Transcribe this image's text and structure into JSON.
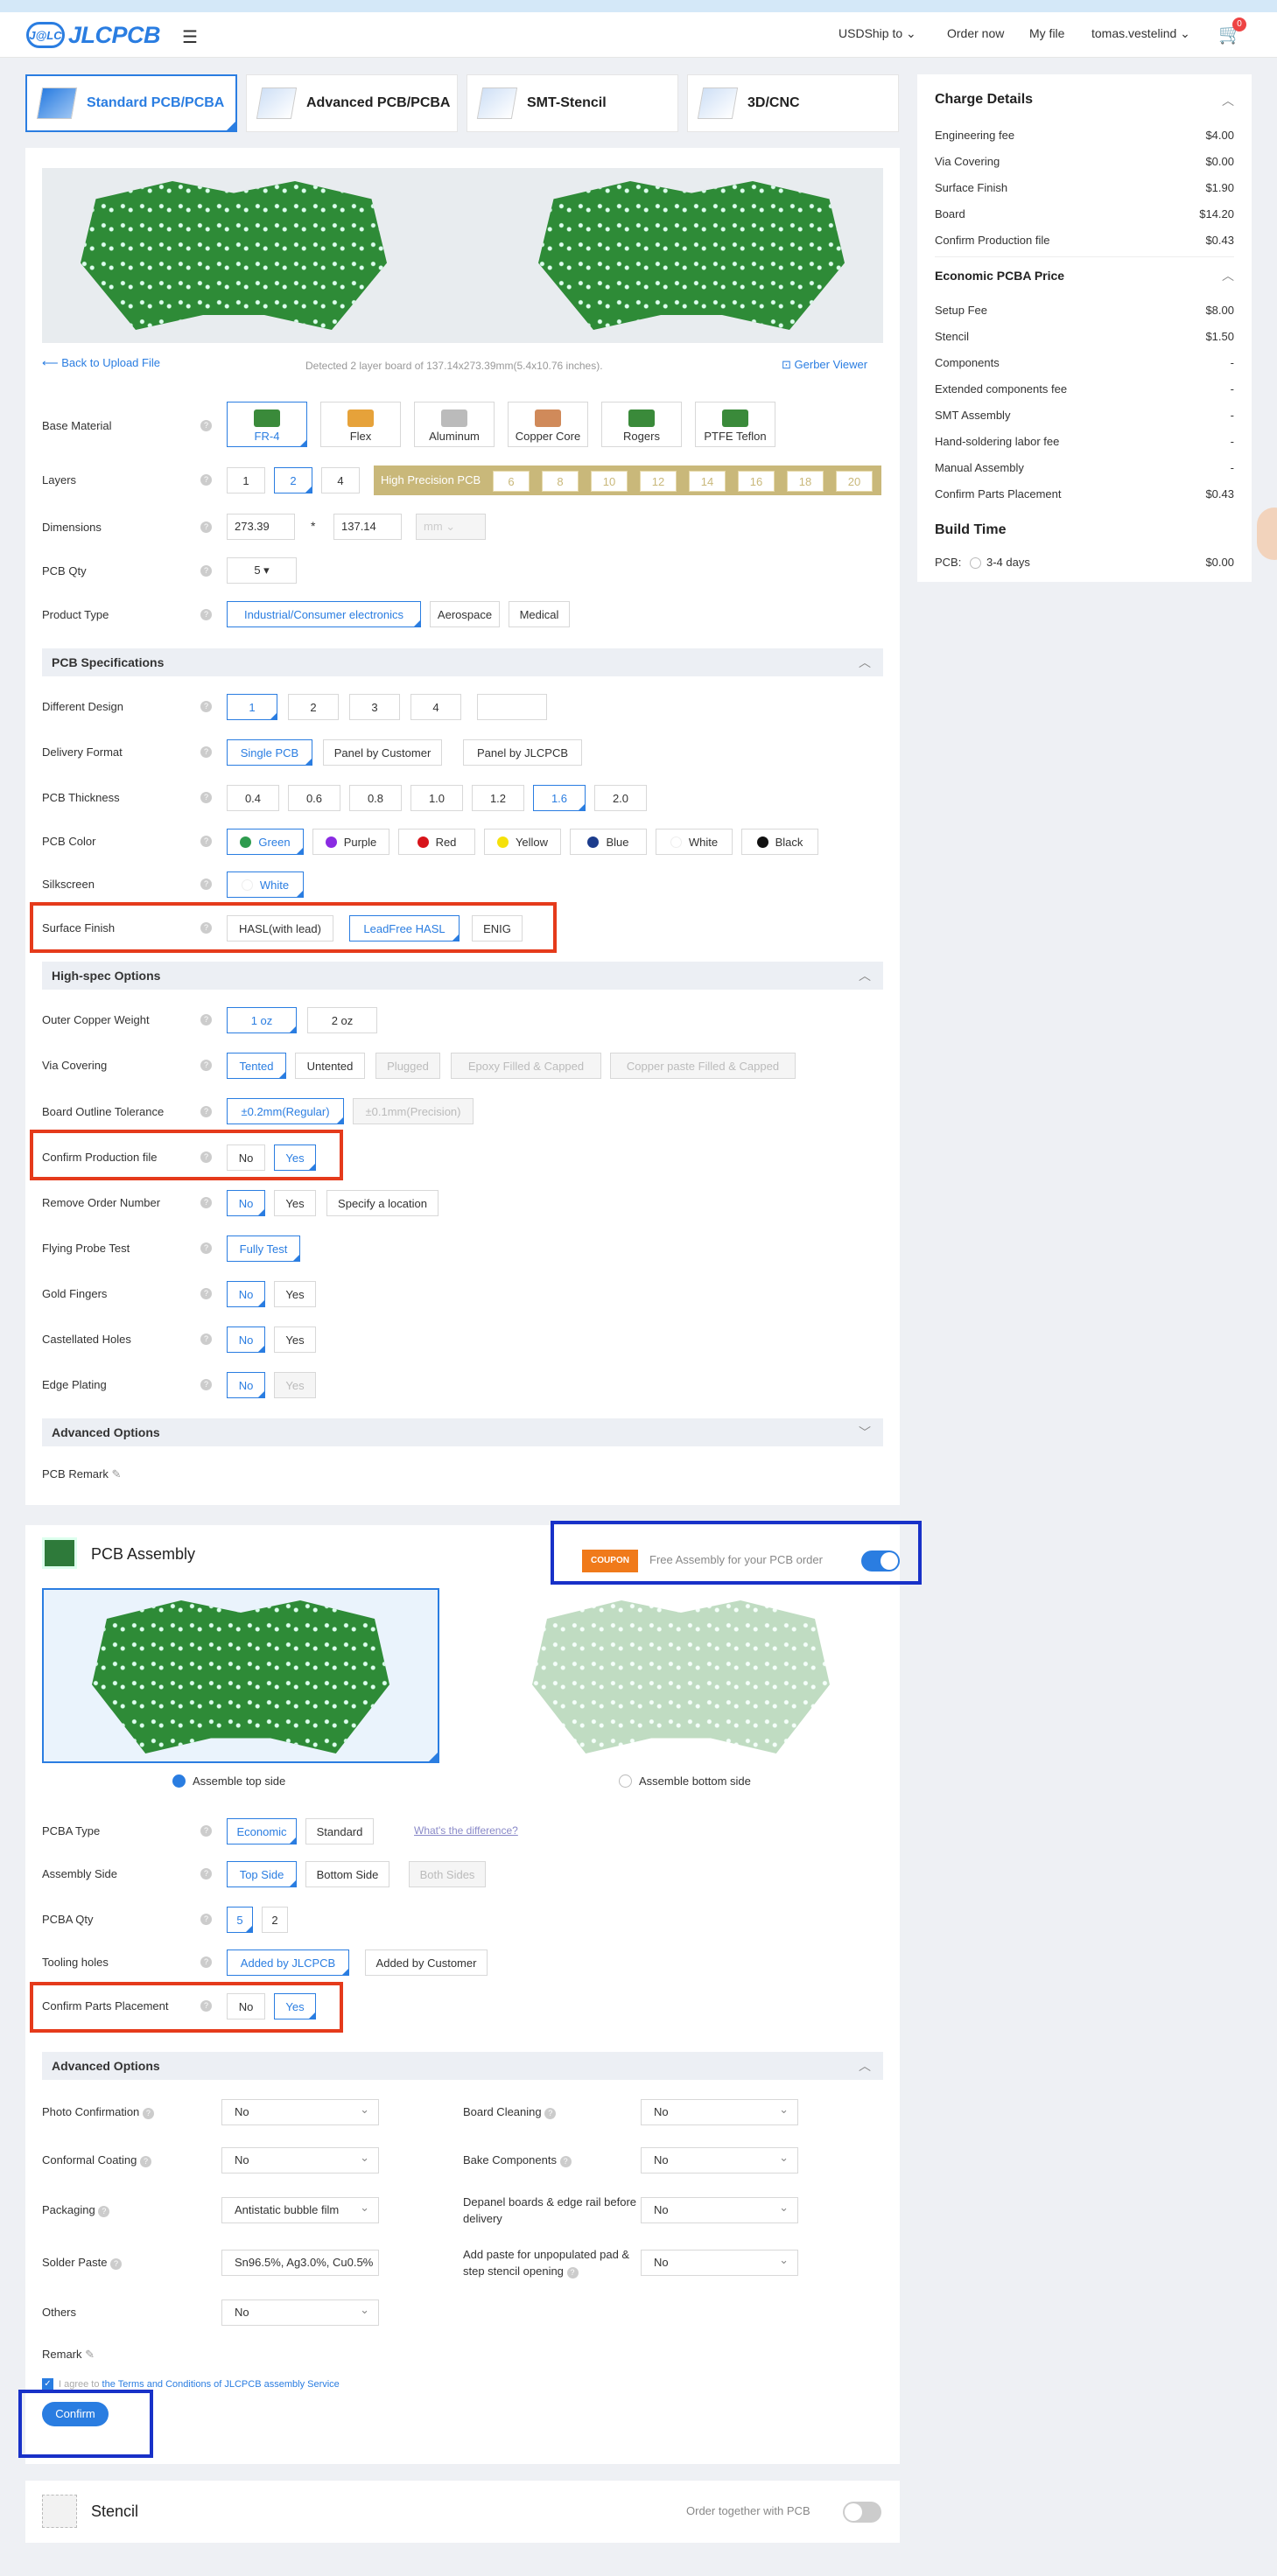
{
  "header": {
    "logo_mark": "J@LC",
    "logo_word": "JLCPCB",
    "currency": "USD",
    "ship_to": "Ship to",
    "order_now": "Order now",
    "my_file": "My file",
    "user": "tomas.vestelind",
    "cart_count": "0"
  },
  "tabs": [
    "Standard PCB/PCBA",
    "Advanced PCB/PCBA",
    "SMT-Stencil",
    "3D/CNC"
  ],
  "upload": {
    "back": "Back to Upload File",
    "detected": "Detected 2 layer board of 137.14x273.39mm(5.4x10.76 inches).",
    "gerber_viewer": "Gerber Viewer"
  },
  "base_material": {
    "label": "Base Material",
    "options": [
      "FR-4",
      "Flex",
      "Aluminum",
      "Copper Core",
      "Rogers",
      "PTFE Teflon"
    ]
  },
  "layers": {
    "label": "Layers",
    "options": [
      "1",
      "2",
      "4"
    ],
    "hp_label": "High Precision PCB",
    "hp_options": [
      "6",
      "8",
      "10",
      "12",
      "14",
      "16",
      "18",
      "20"
    ]
  },
  "dimensions": {
    "label": "Dimensions",
    "w": "273.39",
    "sep": "*",
    "h": "137.14",
    "unit": "mm"
  },
  "qty": {
    "label": "PCB Qty",
    "value": "5"
  },
  "product_type": {
    "label": "Product Type",
    "options": [
      "Industrial/Consumer electronics",
      "Aerospace",
      "Medical"
    ]
  },
  "spec_title": "PCB Specifications",
  "diff_design": {
    "label": "Different Design",
    "options": [
      "1",
      "2",
      "3",
      "4"
    ]
  },
  "delivery": {
    "label": "Delivery Format",
    "options": [
      "Single PCB",
      "Panel by Customer",
      "Panel by JLCPCB"
    ]
  },
  "thickness": {
    "label": "PCB Thickness",
    "options": [
      "0.4",
      "0.6",
      "0.8",
      "1.0",
      "1.2",
      "1.6",
      "2.0"
    ]
  },
  "color": {
    "label": "PCB Color",
    "options": [
      {
        "name": "Green",
        "c": "#2e9b4e"
      },
      {
        "name": "Purple",
        "c": "#8a2be2"
      },
      {
        "name": "Red",
        "c": "#d7141a"
      },
      {
        "name": "Yellow",
        "c": "#f5e10a"
      },
      {
        "name": "Blue",
        "c": "#1c3c8c"
      },
      {
        "name": "White",
        "c": "#ffffff"
      },
      {
        "name": "Black",
        "c": "#111111"
      }
    ]
  },
  "silkscreen": {
    "label": "Silkscreen",
    "value": "White"
  },
  "surface": {
    "label": "Surface Finish",
    "options": [
      "HASL(with lead)",
      "LeadFree HASL",
      "ENIG"
    ]
  },
  "highspec_title": "High-spec Options",
  "copper": {
    "label": "Outer Copper Weight",
    "options": [
      "1 oz",
      "2 oz"
    ]
  },
  "via": {
    "label": "Via Covering",
    "options": [
      "Tented",
      "Untented",
      "Plugged",
      "Epoxy Filled & Capped",
      "Copper paste Filled & Capped"
    ]
  },
  "tolerance": {
    "label": "Board Outline Tolerance",
    "options": [
      "±0.2mm(Regular)",
      "±0.1mm(Precision)"
    ]
  },
  "confirm_file": {
    "label": "Confirm Production file",
    "options": [
      "No",
      "Yes"
    ]
  },
  "remove_order": {
    "label": "Remove Order Number",
    "options": [
      "No",
      "Yes",
      "Specify a location"
    ]
  },
  "flying": {
    "label": "Flying Probe Test",
    "value": "Fully Test"
  },
  "gold": {
    "label": "Gold Fingers",
    "options": [
      "No",
      "Yes"
    ]
  },
  "castellated": {
    "label": "Castellated Holes",
    "options": [
      "No",
      "Yes"
    ]
  },
  "edge": {
    "label": "Edge Plating",
    "options": [
      "No",
      "Yes"
    ]
  },
  "adv_title": "Advanced Options",
  "remark_label": "PCB Remark",
  "assembly": {
    "title": "PCB Assembly",
    "coupon_badge": "COUPON",
    "coupon_text": "Free Assembly for your PCB order",
    "top": "Assemble top side",
    "bottom": "Assemble bottom side",
    "pcba_type": {
      "label": "PCBA Type",
      "options": [
        "Economic",
        "Standard"
      ],
      "diff": "What's the difference?"
    },
    "side": {
      "label": "Assembly Side",
      "options": [
        "Top Side",
        "Bottom Side",
        "Both Sides"
      ]
    },
    "qty": {
      "label": "PCBA Qty",
      "options": [
        "5",
        "2"
      ]
    },
    "tooling": {
      "label": "Tooling holes",
      "options": [
        "Added by JLCPCB",
        "Added by Customer"
      ]
    },
    "confirm_parts": {
      "label": "Confirm Parts Placement",
      "options": [
        "No",
        "Yes"
      ]
    },
    "adv_title": "Advanced Options",
    "photo": {
      "label": "Photo Confirmation",
      "value": "No"
    },
    "cleaning": {
      "label": "Board Cleaning",
      "value": "No"
    },
    "conformal": {
      "label": "Conformal Coating",
      "value": "No"
    },
    "bake": {
      "label": "Bake Components",
      "value": "No"
    },
    "packaging": {
      "label": "Packaging",
      "value": "Antistatic bubble film"
    },
    "depanel": {
      "label": "Depanel boards & edge rail before delivery",
      "value": "No"
    },
    "solder": {
      "label": "Solder Paste",
      "value": "Sn96.5%, Ag3.0%, Cu0.5%"
    },
    "addpaste": {
      "label": "Add paste for unpopulated pad & step stencil opening",
      "value": "No"
    },
    "others": {
      "label": "Others",
      "value": "No"
    },
    "remark": "Remark",
    "agree": "I agree to",
    "terms": "the Terms and Conditions of JLCPCB assembly Service",
    "confirm": "Confirm"
  },
  "stencil": {
    "title": "Stencil",
    "order_together": "Order together with PCB"
  },
  "charge": {
    "title": "Charge Details",
    "rows": [
      [
        "Engineering fee",
        "$4.00"
      ],
      [
        "Via Covering",
        "$0.00"
      ],
      [
        "Surface Finish",
        "$1.90"
      ],
      [
        "Board",
        "$14.20"
      ],
      [
        "Confirm Production file",
        "$0.43"
      ]
    ],
    "pcba_title": "Economic PCBA Price",
    "pcba_rows": [
      [
        "Setup Fee",
        "$8.00"
      ],
      [
        "Stencil",
        "$1.50"
      ],
      [
        "Components",
        "-"
      ],
      [
        "Extended components fee",
        "-"
      ],
      [
        "SMT Assembly",
        "-"
      ],
      [
        "Hand-soldering labor fee",
        "-"
      ],
      [
        "Manual Assembly",
        "-"
      ],
      [
        "Confirm Parts Placement",
        "$0.43"
      ]
    ],
    "build_title": "Build Time",
    "build_label": "PCB:",
    "build_option": "3-4 days",
    "build_price": "$0.00"
  }
}
